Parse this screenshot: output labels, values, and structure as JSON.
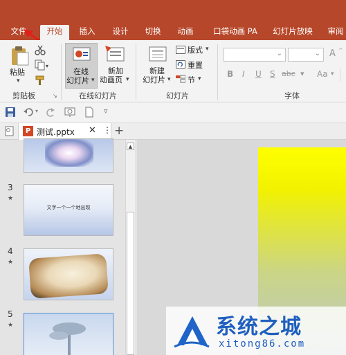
{
  "ribbon_tabs": [
    "文件",
    "开始",
    "插入",
    "设计",
    "切换",
    "动画",
    "口袋动画 PA",
    "幻灯片放映",
    "审阅"
  ],
  "clipboard": {
    "paste": "粘贴",
    "group": "剪贴板"
  },
  "online_slides": {
    "btn1_line1": "在线",
    "btn1_line2": "幻灯片",
    "btn2_line1": "新加",
    "btn2_line2": "动画页",
    "group": "在线幻灯片"
  },
  "slides_group": {
    "new_line1": "新建",
    "new_line2": "幻灯片",
    "layout": "版式",
    "reset": "重置",
    "section": "节",
    "group": "幻灯片"
  },
  "font_group": {
    "bold": "B",
    "italic": "I",
    "underline": "U",
    "strike": "S",
    "spacing": "abc",
    "case": "Aa",
    "group": "字体",
    "increase": "A",
    "decrease": "A"
  },
  "document": {
    "filename": "测试.pptx"
  },
  "slides": [
    {
      "number": "3",
      "text": "文字一个一个地出现"
    },
    {
      "number": "4"
    },
    {
      "number": "5"
    }
  ],
  "watermark": {
    "brand": "系统之城",
    "url": "xitong86.com"
  },
  "colors": {
    "accent": "#b7472a",
    "slide_top": "#ffff00"
  }
}
